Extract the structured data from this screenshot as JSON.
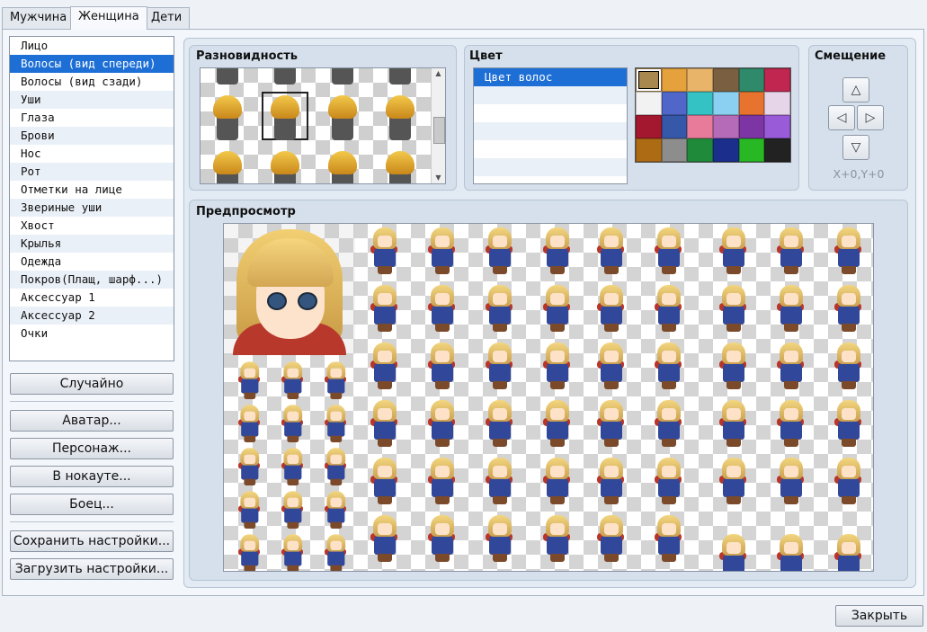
{
  "tabs": [
    {
      "label": "Мужчина",
      "active": false
    },
    {
      "label": "Женщина",
      "active": true
    },
    {
      "label": "Дети",
      "active": false
    }
  ],
  "categories": [
    "Лицо",
    "Волосы (вид спереди)",
    "Волосы (вид сзади)",
    "Уши",
    "Глаза",
    "Брови",
    "Нос",
    "Рот",
    "Отметки на лице",
    "Звериные уши",
    "Хвост",
    "Крылья",
    "Одежда",
    "Покров(Плащ, шарф...)",
    "Аксессуар 1",
    "Аксессуар 2",
    "Очки"
  ],
  "selected_category": 1,
  "buttons": {
    "random": "Случайно",
    "avatar": "Аватар...",
    "character": "Персонаж...",
    "knockout": "В нокауте...",
    "fighter": "Боец...",
    "save_settings": "Сохранить настройки...",
    "load_settings": "Загрузить настройки...",
    "close": "Закрыть"
  },
  "variety": {
    "title": "Разновидность",
    "selected_index": 5
  },
  "color": {
    "title": "Цвет",
    "items": [
      "Цвет волос",
      "",
      "",
      "",
      "",
      ""
    ],
    "selected": 0,
    "palette": [
      "#a8884f",
      "#e4a13c",
      "#e8b46a",
      "#7a6040",
      "#2f8a6b",
      "#c0264f",
      "#f2f2f2",
      "#5066c9",
      "#34c2c4",
      "#8bd0f0",
      "#e7732e",
      "#e6d5e8",
      "#a3182e",
      "#3558a8",
      "#e87a9a",
      "#b56bb8",
      "#7d35a6",
      "#9a5bd8",
      "#ad6b14",
      "#8d8d8d",
      "#1f8a3a",
      "#1b2e8c",
      "#27b823",
      "#222222"
    ],
    "palette_selected": 0
  },
  "offset": {
    "title": "Смещение",
    "up": "△",
    "down": "▽",
    "left": "◁",
    "right": "▷",
    "readout": "X+0,Y+0"
  },
  "preview": {
    "title": "Предпросмотр"
  }
}
